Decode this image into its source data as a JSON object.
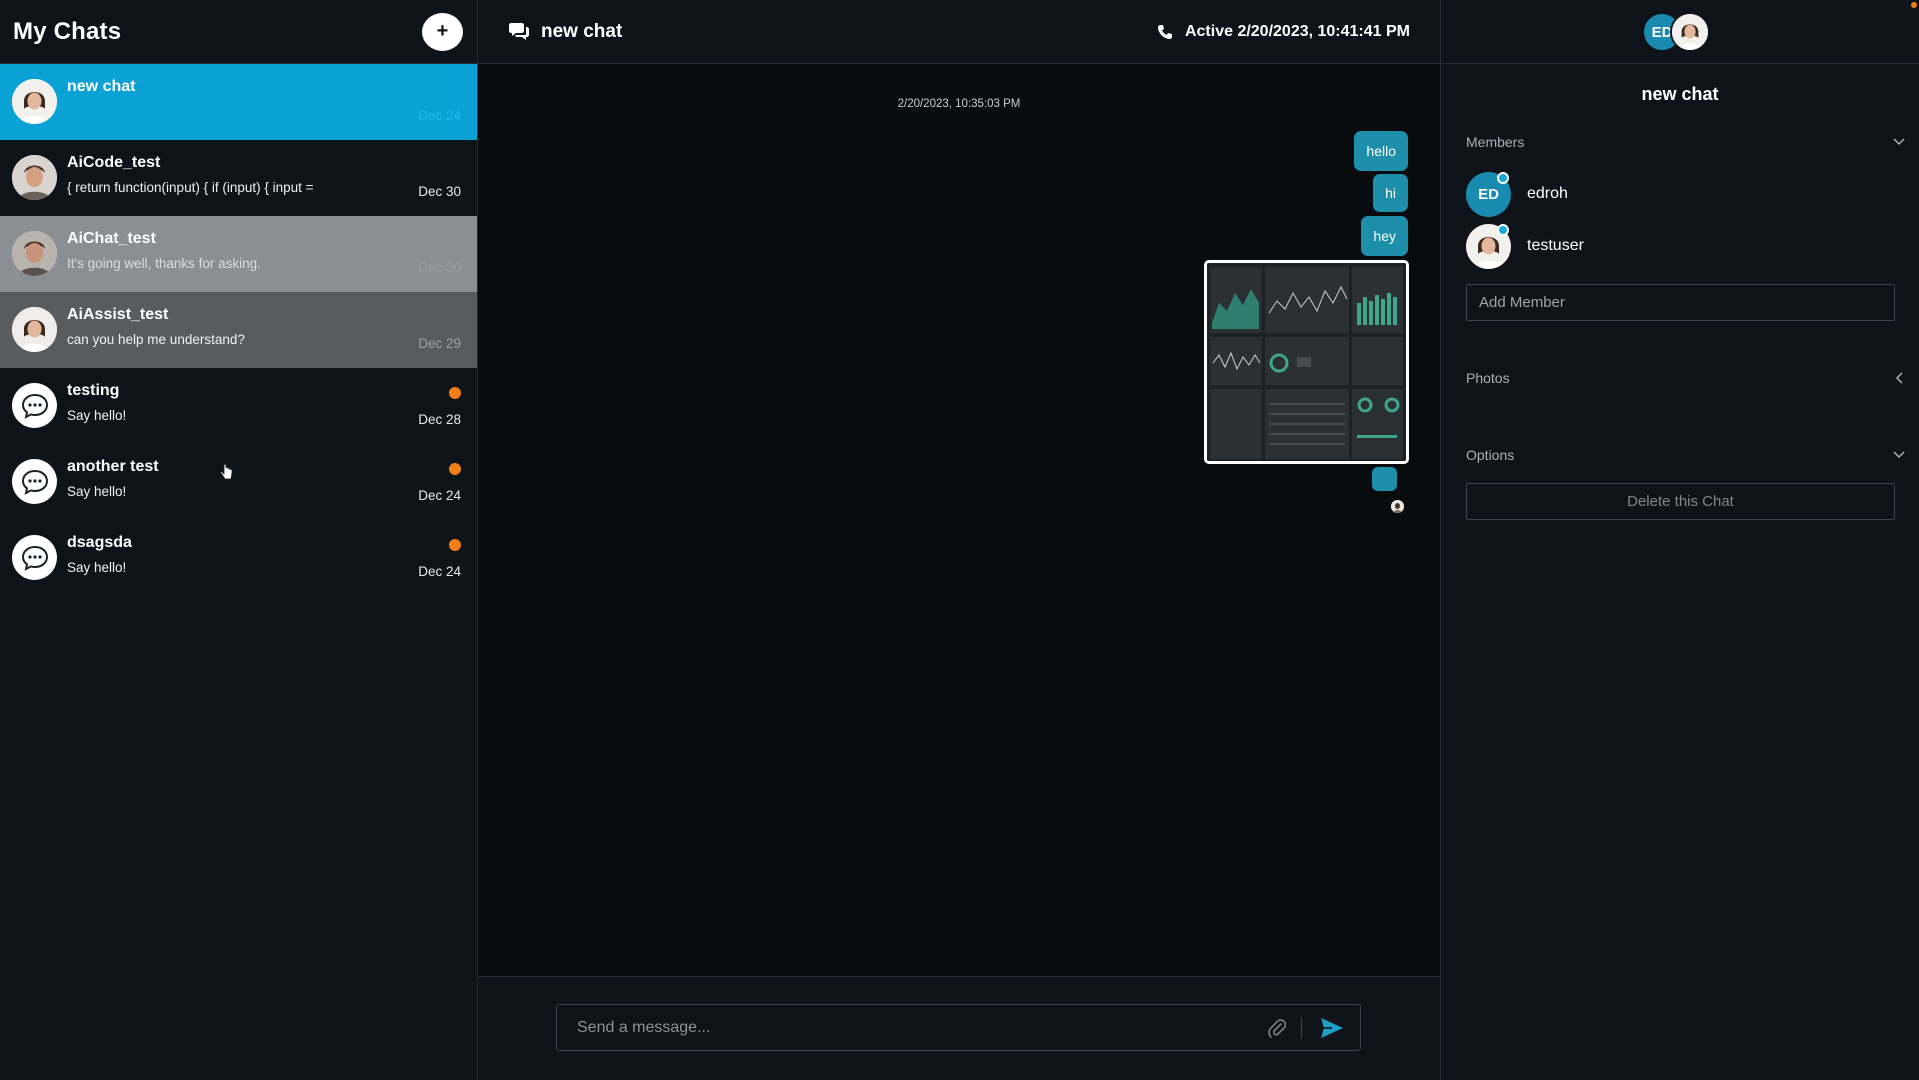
{
  "colors": {
    "accent": "#0aa2d4",
    "bubble": "#1d8fab",
    "unread": "#f07f18",
    "background": "#080c0e",
    "panel": "#0d1318"
  },
  "sidebar": {
    "title": "My Chats",
    "new_chat_label": "+",
    "chats": [
      {
        "name": "new chat",
        "preview": "",
        "date": "Dec 24",
        "avatar": "person-photo-icon",
        "unread": false
      },
      {
        "name": "AiCode_test",
        "preview": "{ return function(input) { if (input) { input =",
        "date": "Dec 30",
        "avatar": "person-photo-icon",
        "unread": false
      },
      {
        "name": "AiChat_test",
        "preview": "It's going well, thanks for asking.",
        "date": "Dec 30",
        "avatar": "person-photo-icon",
        "unread": false
      },
      {
        "name": "AiAssist_test",
        "preview": "can you help me understand?",
        "date": "Dec 29",
        "avatar": "person-photo-icon",
        "unread": false
      },
      {
        "name": "testing",
        "preview": "Say hello!",
        "date": "Dec 28",
        "avatar": "chat-bubble-icon",
        "unread": true
      },
      {
        "name": "another test",
        "preview": "Say hello!",
        "date": "Dec 24",
        "avatar": "chat-bubble-icon",
        "unread": true
      },
      {
        "name": "dsagsda",
        "preview": "Say hello!",
        "date": "Dec 24",
        "avatar": "chat-bubble-icon",
        "unread": true
      }
    ]
  },
  "conversation": {
    "title": "new chat",
    "title_icon": "chat-bubbles-icon",
    "status_icon": "phone-icon",
    "status": "Active 2/20/2023, 10:41:41 PM",
    "timestamp": "2/20/2023, 10:35:03 PM",
    "messages": [
      {
        "type": "text",
        "text": "hello"
      },
      {
        "type": "text",
        "text": "hi"
      },
      {
        "type": "text",
        "text": "hey"
      },
      {
        "type": "image",
        "text": "dashboard screenshot"
      },
      {
        "type": "text",
        "text": ""
      }
    ],
    "composer": {
      "placeholder": "Send a message...",
      "attach_icon": "paperclip-icon",
      "send_icon": "send-icon"
    }
  },
  "details": {
    "title": "new chat",
    "header_avatars": [
      "ED",
      "person-photo-icon"
    ],
    "members_label": "Members",
    "members": [
      {
        "name": "edroh",
        "initials": "ED",
        "online": true
      },
      {
        "name": "testuser",
        "initials": "",
        "online": true
      }
    ],
    "add_member_placeholder": "Add Member",
    "photos_label": "Photos",
    "options_label": "Options",
    "delete_label": "Delete this Chat"
  }
}
